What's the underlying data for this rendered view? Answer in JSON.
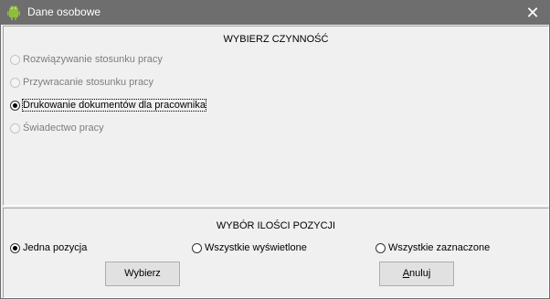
{
  "window": {
    "title": "Dane osobowe",
    "close_glyph": "✕",
    "app_icon": "android-icon"
  },
  "activity": {
    "title": "WYBIERZ CZYNNOŚĆ",
    "options": [
      {
        "label": "Rozwiązywanie stosunku pracy",
        "selected": false,
        "enabled": false
      },
      {
        "label": "Przywracanie stosunku pracy",
        "selected": false,
        "enabled": false
      },
      {
        "label": "Drukowanie dokumentów dla pracownika",
        "selected": true,
        "enabled": true
      },
      {
        "label": "Świadectwo pracy",
        "selected": false,
        "enabled": false
      }
    ]
  },
  "scope": {
    "title": "WYBÓR ILOŚCI POZYCJI",
    "options": [
      {
        "label": "Jedna pozycja",
        "selected": true
      },
      {
        "label": "Wszystkie wyświetlone",
        "selected": false
      },
      {
        "label": "Wszystkie zaznaczone",
        "selected": false
      }
    ]
  },
  "buttons": {
    "select": "Wybierz",
    "cancel_mnemonic": "A",
    "cancel_rest": "nuluj"
  },
  "colors": {
    "titlebar": "#6e6e6e",
    "icon_green": "#8fbf3a"
  }
}
